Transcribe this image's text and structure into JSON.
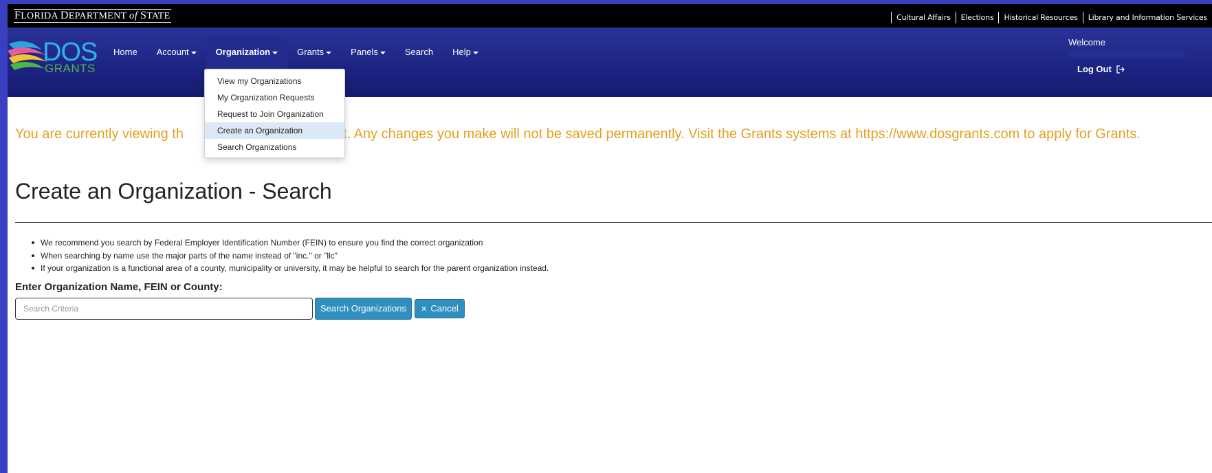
{
  "state_bar": {
    "logo_parts": [
      "F",
      "LORIDA ",
      "D",
      "EPARTMENT ",
      "of",
      " ",
      "S",
      "TATE"
    ],
    "links": [
      "Cultural Affairs",
      "Elections",
      "Historical Resources",
      "Library and Information Services"
    ]
  },
  "brand": {
    "dos": "DOS",
    "grants": "GRANTS"
  },
  "nav": {
    "items": [
      {
        "label": "Home",
        "has_caret": false
      },
      {
        "label": "Account",
        "has_caret": true
      },
      {
        "label": "Organization",
        "has_caret": true,
        "active": true
      },
      {
        "label": "Grants",
        "has_caret": true
      },
      {
        "label": "Panels",
        "has_caret": true
      },
      {
        "label": "Search",
        "has_caret": false
      },
      {
        "label": "Help",
        "has_caret": true
      }
    ],
    "welcome": "Welcome",
    "logout": "Log Out",
    "logout_icon": "sign-out-icon"
  },
  "dropdown": {
    "items": [
      "View my Organizations",
      "My Organization Requests",
      "Request to Join Organization",
      "Create an Organization",
      "Search Organizations"
    ],
    "highlighted_index": 3
  },
  "notice": {
    "visible_text_left": "You are currently viewing th",
    "visible_text_right": "nt. Any changes you make will not be saved permanently. Visit the Grants systems at https://www.dosgrants.com to apply for Grants."
  },
  "page": {
    "title": "Create an Organization - Search",
    "tips": [
      "We recommend you search by Federal Employer Identification Number (FEIN) to ensure you find the correct organization",
      "When searching by name use the major parts of the name instead of \"inc.\" or \"llc\"",
      "If your organization is a functional area of a county, municipality or university, it may be helpful to search for the parent organization instead."
    ],
    "field_label": "Enter Organization Name, FEIN or County:",
    "search_placeholder": "Search Criteria",
    "search_value": "",
    "search_button": "Search Organizations",
    "cancel_button": "Cancel",
    "cancel_icon": "close-icon"
  },
  "colors": {
    "navbar": "#1c2382",
    "notice": "#e3a020",
    "button": "#2f8fbe",
    "dropdown_highlight": "#dbe8f5"
  }
}
